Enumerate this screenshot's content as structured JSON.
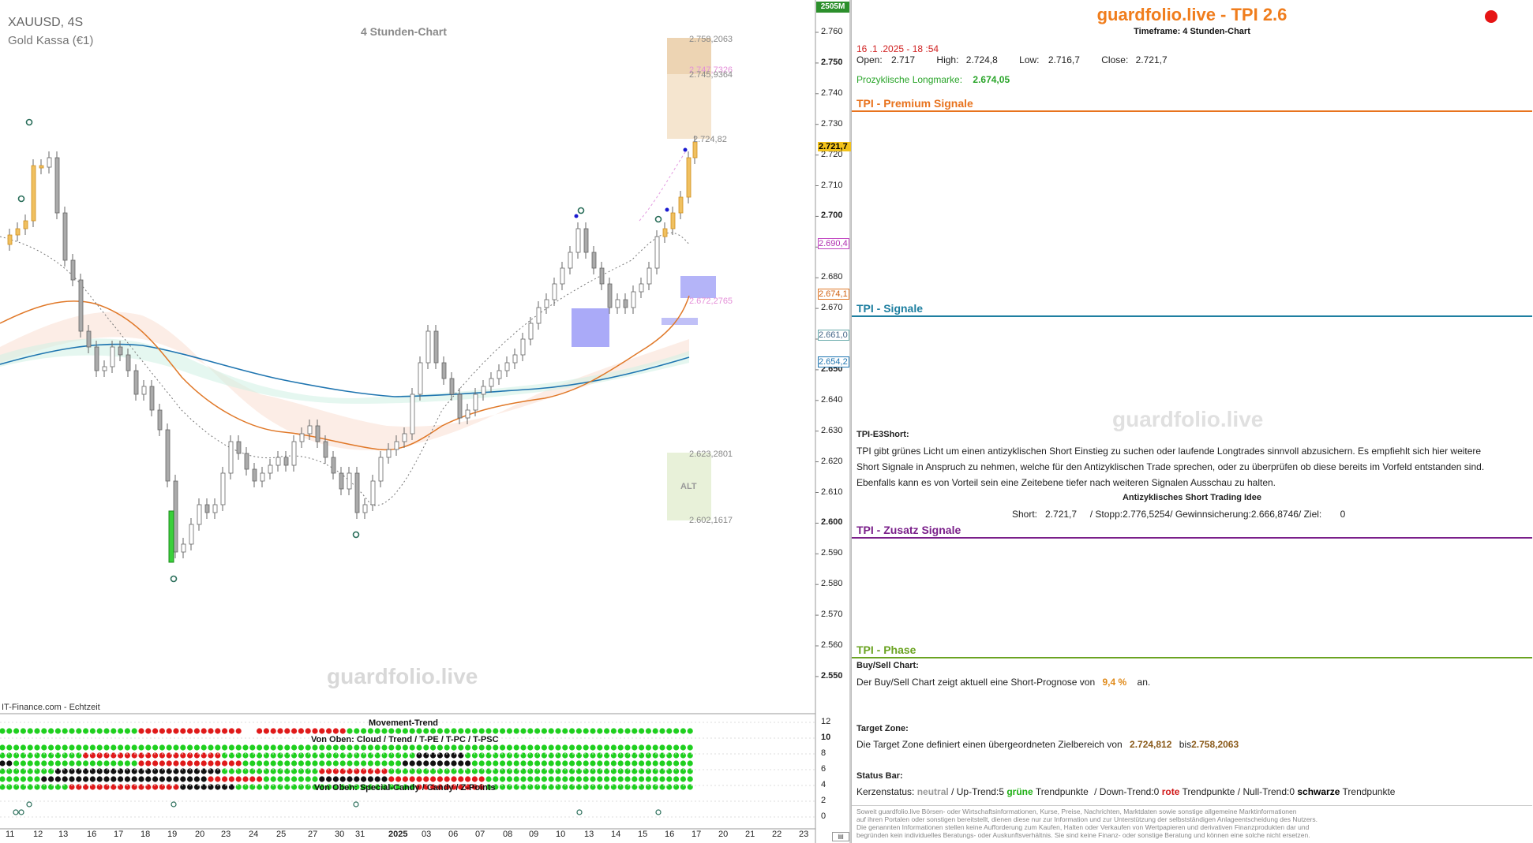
{
  "chart": {
    "symbol": "XAUUSD, 4S",
    "instrument": "Gold Kassa (€1)",
    "timeframe_label": "4 Stunden-Chart",
    "source": "IT-Finance.com - Echtzeit",
    "watermark": "guardfolio.live",
    "volume_badge": "2505M",
    "price_ticks": [
      "2.760",
      "2.750",
      "2.740",
      "2.730",
      "2.720",
      "2.710",
      "2.700",
      "2.690",
      "2.680",
      "2.670",
      "2.660",
      "2.650",
      "2.640",
      "2.630",
      "2.620",
      "2.610",
      "2.600",
      "2.590",
      "2.580",
      "2.570",
      "2.560",
      "2.550"
    ],
    "price_markers": {
      "last": "2.721,7",
      "m1": "2.690,4",
      "m2": "2.674,1",
      "m3": "2.661,0",
      "m4": "2.654,2"
    },
    "zone_labels": {
      "top": "2.758,2063",
      "top2": "2.747,7326",
      "top3": "2.745,9364",
      "target": "2.724,82",
      "mid": "2.672,2765",
      "alt_top": "2.623,2801",
      "alt_bottom": "2.602,1617",
      "alt": "ALT"
    },
    "x_ticks": [
      "11",
      "12",
      "13",
      "16",
      "17",
      "18",
      "19",
      "20",
      "23",
      "24",
      "25",
      "27",
      "30",
      "31",
      "2025",
      "03",
      "06",
      "07",
      "08",
      "09",
      "10",
      "13",
      "14",
      "15",
      "16",
      "17",
      "20",
      "21",
      "22",
      "23"
    ],
    "indicator": {
      "title1": "Movement-Trend",
      "title2": "Von Oben: Cloud / Trend / T-PE / T-PC / T-PSC",
      "title3": "Von Oben: Special-Candy / Candy / Z-Points",
      "scale": [
        "12",
        "10",
        "8",
        "6",
        "4",
        "2",
        "0"
      ]
    }
  },
  "panel": {
    "title": "guardfolio.live - TPI 2.6",
    "timeframe": "Timeframe: 4 Stunden-Chart",
    "datetime": "16 .1 .2025  - 18 :54",
    "ohlc": {
      "open_label": "Open:",
      "open": "2.717",
      "high_label": "High:",
      "high": "2.724,8",
      "low_label": "Low:",
      "low": "2.716,7",
      "close_label": "Close:",
      "close": "2.721,7"
    },
    "longmark_label": "Prozyklische Longmarke:",
    "longmark_value": "2.674,05",
    "sections": {
      "premium": "TPI - Premium Signale",
      "signale": "TPI - Signale",
      "zusatz": "TPI - Zusatz Signale",
      "phase": "TPI - Phase"
    },
    "watermark": "guardfolio.live",
    "e3": {
      "heading": "TPI-E3Short:",
      "line1": "TPI gibt grünes Licht um einen antizyklischen Short Einstieg zu suchen oder laufende Longtrades sinnvoll abzusichern. Es empfiehlt sich hier weitere",
      "line2": "Short Signale in Anspruch zu nehmen, welche für den Antizyklischen Trade sprechen, oder zu überprüfen ob diese bereits im Vorfeld entstanden sind.",
      "line3": "Ebenfalls kann es von Vorteil sein eine Zeitebene tiefer nach weiteren Signalen Ausschau zu halten.",
      "idea_title": "Antizyklisches Short Trading Idee",
      "idea_line": "Short:   2.721,7     / Stopp:2.776,5254/ Gewinnsicherung:2.666,8746/ Ziel:       0"
    },
    "buysell": {
      "heading": "Buy/Sell Chart:",
      "text_before": "Der Buy/Sell Chart zeigt aktuell eine Short-Prognose von",
      "value": "9,4 %",
      "text_after": "an."
    },
    "target": {
      "heading": "Target Zone:",
      "text_before": "Die Target Zone definiert einen übergeordneten Zielbereich von",
      "from": "2.724,812",
      "mid": "bis",
      "to": "2.758,2063"
    },
    "status": {
      "heading": "Status Bar:",
      "kern_label": "Kerzenstatus:",
      "kern_value": "neutral",
      "up": "/ Up-Trend:5",
      "gruene": "grüne",
      "tp1": "Trendpunkte",
      "down": "/ Down-Trend:0",
      "rote": "rote",
      "tp2": "Trendpunkte",
      "null": "/ Null-Trend:0",
      "schwarze": "schwarze",
      "tp3": "Trendpunkte"
    },
    "disclaimer": [
      "Soweit guardfolio.live Börsen- oder Wirtschaftsinformationen, Kurse, Preise, Nachrichten, Marktdaten sowie sonstige allgemeine Marktinformationen",
      "auf ihren Portalen oder sonstigen bereitstellt, dienen diese nur zur Information und zur Unterstützung der selbstständigen Anlageentscheidung des Nutzers.",
      "Die genannten Informationen stellen keine Aufforderung zum Kaufen, Halten oder Verkaufen von Wertpapieren und derivativen Finanzprodukten dar und",
      "begründen kein individuelles Beratungs- oder Auskunftsverhältnis. Sie sind keine Finanz- oder sonstige Beratung und können eine solche nicht ersetzen."
    ],
    "colors": {
      "title": "#f07d1c",
      "premium": "#e8731e",
      "signale": "#1e7fa0",
      "zusatz": "#7a1f8a",
      "phase": "#6aa321",
      "green": "#1fb014",
      "red": "#d01818",
      "record": "#e61414"
    }
  }
}
